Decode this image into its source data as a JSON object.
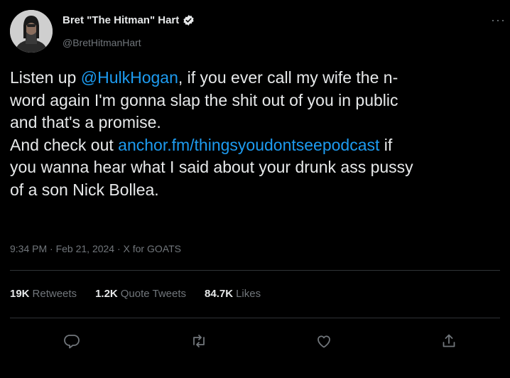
{
  "author": {
    "name": "Bret \"The Hitman\" Hart",
    "handle": "@BretHitmanHart",
    "verified": true
  },
  "more_label": "···",
  "tweet": {
    "lines": [
      [
        {
          "text": "Listen up "
        },
        {
          "text": "@HulkHogan",
          "link": true
        },
        {
          "text": ", if you ever call my wife the n-"
        }
      ],
      [
        {
          "text": "word again I'm gonna slap the shit out of you in public"
        }
      ],
      [
        {
          "text": "and that's a promise."
        }
      ],
      [
        {
          "text": "And check out "
        },
        {
          "text": "anchor.fm/thingsyoudontseepodcast",
          "link": true
        },
        {
          "text": " if"
        }
      ],
      [
        {
          "text": "you wanna hear what I said about your drunk ass pussy"
        }
      ],
      [
        {
          "text": "of a son Nick Bollea."
        }
      ]
    ]
  },
  "meta": "9:34 PM · Feb 21, 2024 · X for GOATS",
  "stats": {
    "retweets": {
      "count": "19K",
      "label": "Retweets"
    },
    "quotes": {
      "count": "1.2K",
      "label": "Quote Tweets"
    },
    "likes": {
      "count": "84.7K",
      "label": "Likes"
    }
  },
  "icons": {
    "reply": "reply-icon",
    "retweet": "retweet-icon",
    "like": "like-icon",
    "share": "share-icon",
    "verified": "verified-badge-icon"
  },
  "colors": {
    "background": "#000000",
    "text": "#e7e9ea",
    "secondary": "#71767b",
    "link": "#1d9bf0",
    "divider": "#2f3336"
  }
}
